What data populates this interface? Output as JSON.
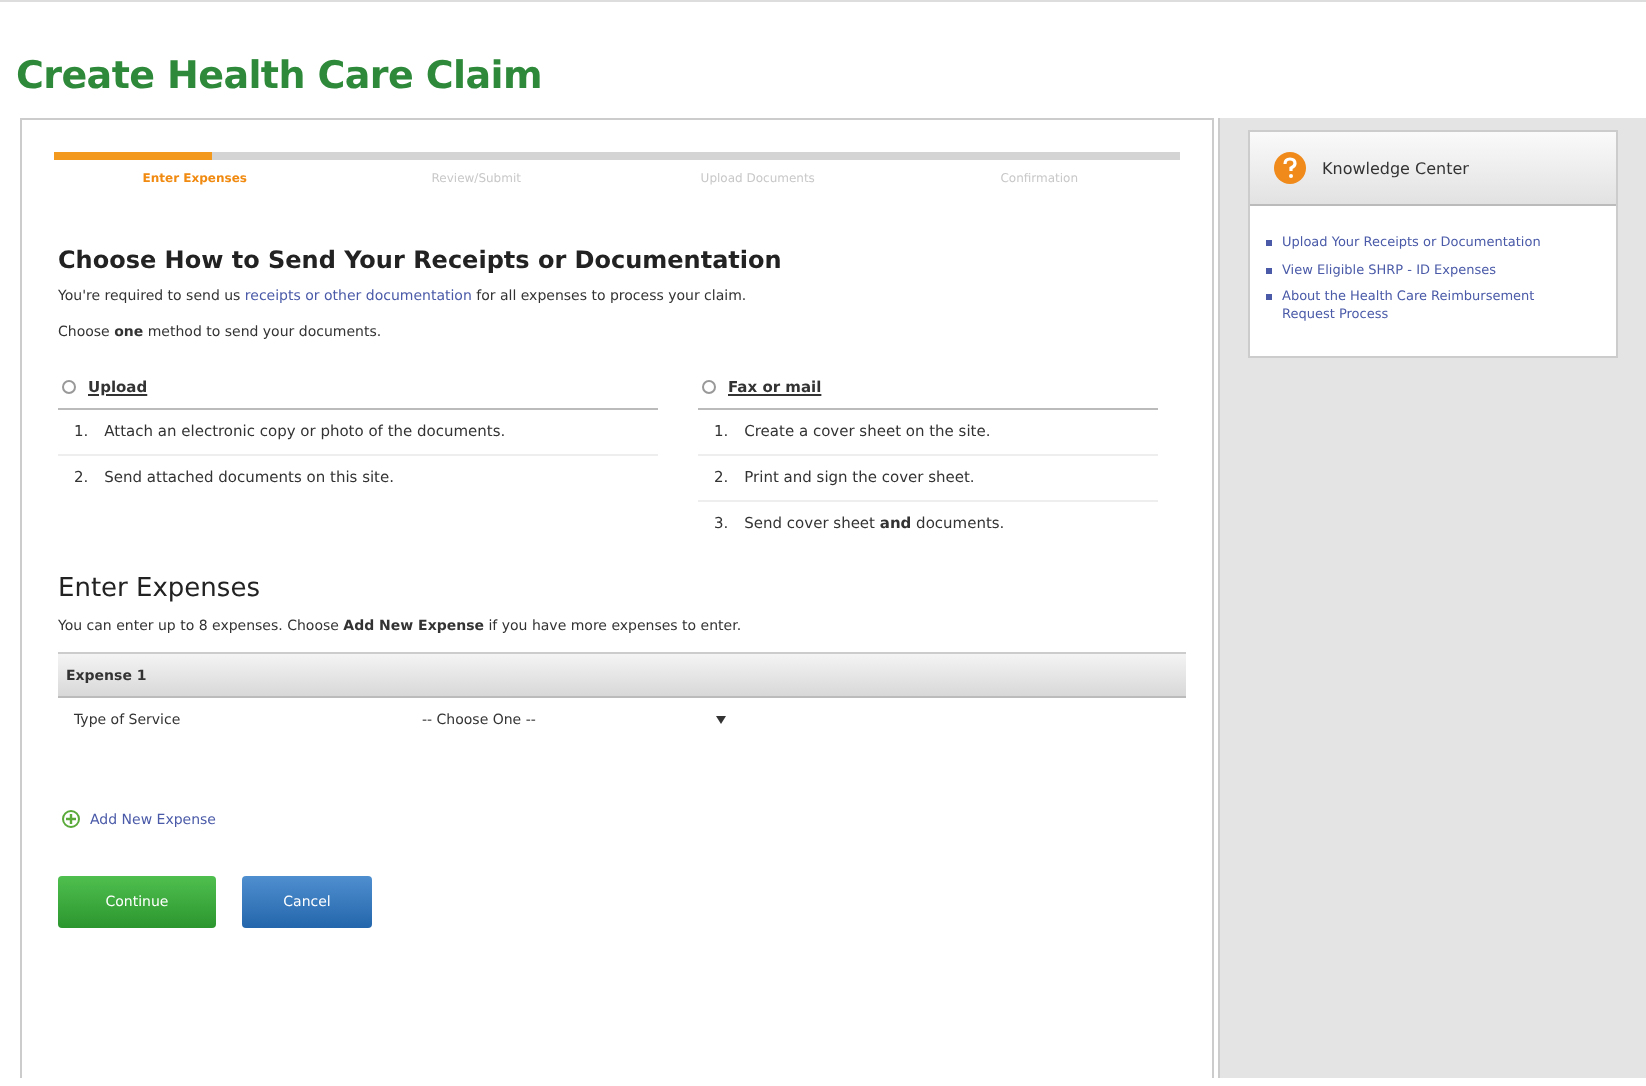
{
  "title": "Create Health Care Claim",
  "progress": {
    "level": 0.14,
    "steps": [
      {
        "label": "Enter Expenses",
        "selected": true
      },
      {
        "label": "Review/Submit",
        "selected": false
      },
      {
        "label": "Upload Documents",
        "selected": false
      },
      {
        "label": "Confirmation",
        "selected": false
      }
    ]
  },
  "send_section": {
    "heading": "Choose How to Send Your Receipts or Documentation",
    "intro_parts": [
      "You're required to send us ",
      "receipts or other documentation",
      " for all expenses to process your claim."
    ],
    "instruction": "Choose **one** method to send your documents.",
    "methods": [
      {
        "label": "Upload",
        "selected": false,
        "steps": [
          {
            "number": "1.",
            "text": "Attach an electronic copy or photo of the documents."
          },
          {
            "number": "2.",
            "text": "Send attached documents on this site."
          }
        ]
      },
      {
        "label": "Fax or mail",
        "selected": false,
        "steps": [
          {
            "number": "1.",
            "text": "Create a cover sheet on the site."
          },
          {
            "number": "2.",
            "text": "Print and sign the cover sheet."
          },
          {
            "number": "3.",
            "text": "Send cover sheet **and** documents."
          }
        ]
      }
    ]
  },
  "expenses": {
    "heading": "Enter Expenses",
    "intro": "You can enter up to 8 expenses. Choose **Add New Expense** if you have more expenses to enter.",
    "expense_header": "Expense 1",
    "field_label": "Type of Service",
    "select_value": "-- Choose One --",
    "add_link": "Add New Expense"
  },
  "buttons": [
    {
      "label": "Continue",
      "kind": "primary"
    },
    {
      "label": "Cancel",
      "kind": "secondary"
    }
  ],
  "knowledge_center": {
    "title": "Knowledge Center",
    "links": [
      "Upload Your Receipts or Documentation",
      "View Eligible SHRP - ID Expenses",
      "About the Health Care Reimbursement Request Process"
    ]
  }
}
